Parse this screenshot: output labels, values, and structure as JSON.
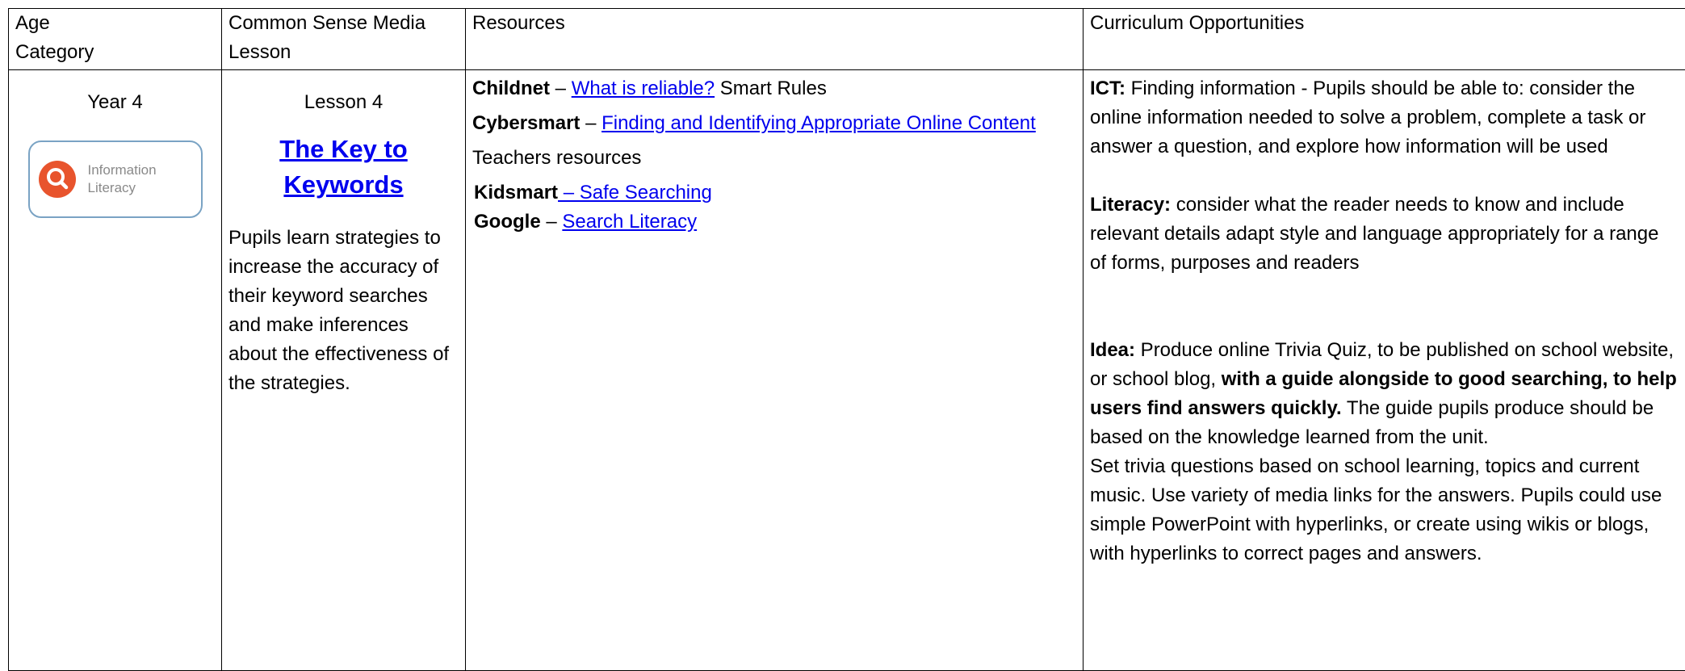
{
  "headers": {
    "age": "Age\nCategory",
    "lesson": "Common Sense Media\nLesson",
    "resources": "Resources",
    "curriculum": "Curriculum Opportunities"
  },
  "age": {
    "year": "Year 4",
    "logo_line1": "Information",
    "logo_line2": "Literacy",
    "logo_color": "#e8542d"
  },
  "lesson": {
    "number": "Lesson 4",
    "title_line1": "The Key to",
    "title_line2": "Keywords",
    "description": "Pupils learn strategies to increase the accuracy of their keyword searches and make inferences about the effectiveness of the strategies."
  },
  "resources": {
    "childnet_label": "Childnet",
    "childnet_sep": " – ",
    "childnet_link": "What is reliable?",
    "childnet_suffix": " Smart Rules",
    "cybersmart_label": "Cybersmart",
    "cybersmart_sep": " – ",
    "cybersmart_link": "Finding and Identifying Appropriate Online Content",
    "teachers": "Teachers resources",
    "kidsmart_label": "Kidsmart",
    "kidsmart_link": " – Safe Searching",
    "google_label": "Google",
    "google_sep": " – ",
    "google_link": "Search Literacy"
  },
  "curriculum": {
    "ict_label": "ICT:",
    "ict_text": " Finding information - Pupils should be able to: consider the online information needed to solve a problem, complete a task or answer a question, and explore how information will be used",
    "literacy_label": "Literacy:",
    "literacy_text": " consider what the reader needs to know and include relevant details adapt style and language appropriately for a range of forms, purposes and readers",
    "idea_label": "Idea:",
    "idea_text1": " Produce online Trivia Quiz, to be published on school website, or school blog, ",
    "idea_bold": "with a guide alongside to good searching, to help users find answers quickly.",
    "idea_text2": " The guide pupils produce should be based on the knowledge learned from the unit.",
    "idea_para2": "Set trivia questions based on school learning, topics and current music. Use variety of media links for the answers. Pupils could use simple PowerPoint with hyperlinks, or create using wikis or blogs, with hyperlinks to correct pages and answers."
  }
}
